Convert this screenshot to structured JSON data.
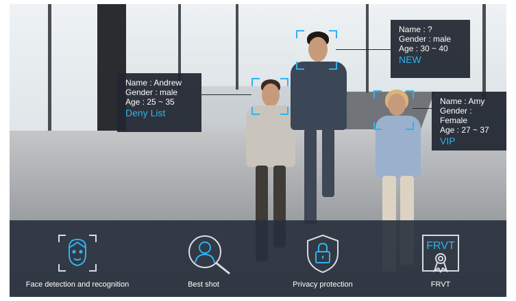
{
  "persons": [
    {
      "name_line": "Name : Andrew",
      "gender_line": "Gender : male",
      "age_line": "Age : 25 ~ 35",
      "tag": "Deny List"
    },
    {
      "name_line": "Name : ?",
      "gender_line": "Gender : male",
      "age_line": "Age : 30 ~ 40",
      "tag": "NEW"
    },
    {
      "name_line": "Name : Amy",
      "gender_line": "Gender : Female",
      "age_line": "Age : 27 ~ 37",
      "tag": "VIP"
    }
  ],
  "features": [
    {
      "label": "Face detection and recognition",
      "icon": "face-detection-icon"
    },
    {
      "label": "Best shot",
      "icon": "best-shot-icon"
    },
    {
      "label": "Privacy protection",
      "icon": "privacy-shield-icon"
    },
    {
      "label": "FRVT",
      "icon": "frvt-certificate-icon",
      "badge_text": "FRVT"
    }
  ],
  "colors": {
    "accent": "#2eb3f0",
    "panel": "#202630",
    "bar": "#28303c"
  }
}
